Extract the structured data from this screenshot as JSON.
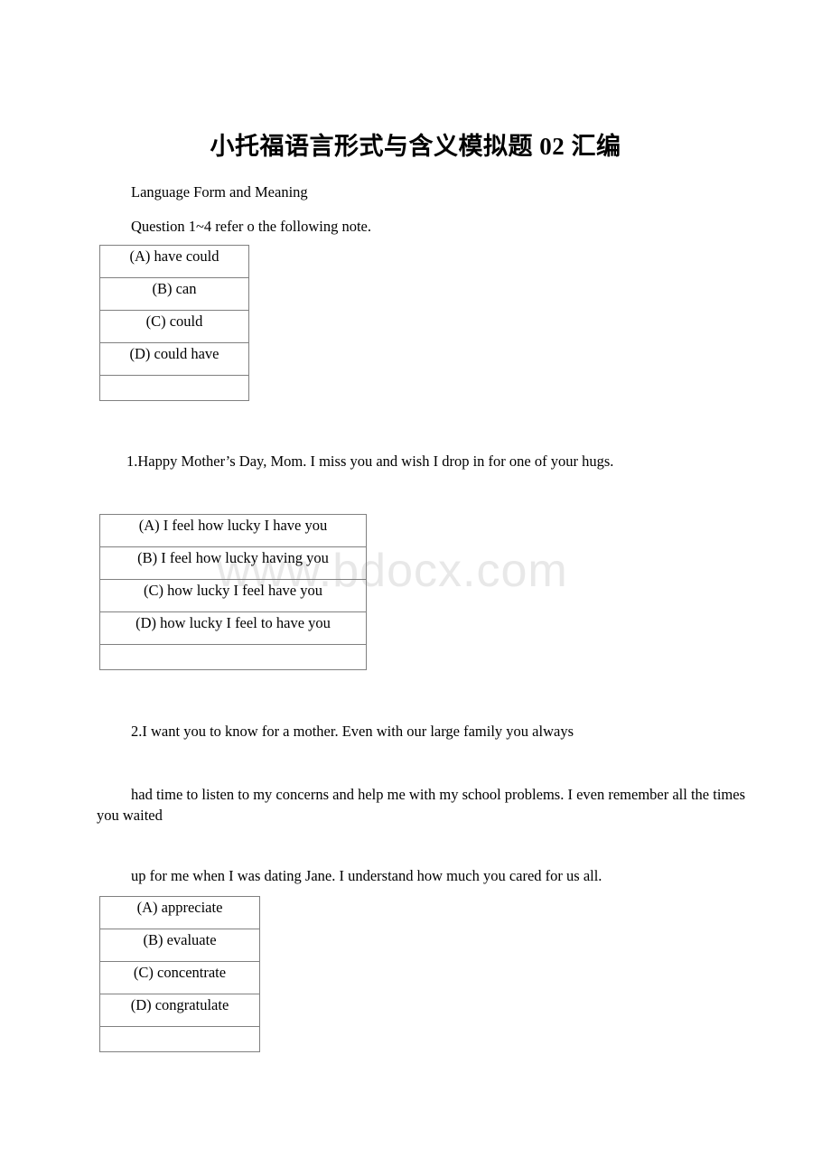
{
  "document": {
    "title": "小托福语言形式与含义模拟题 02 汇编",
    "section_heading": "Language Form and Meaning",
    "instruction": "Question 1~4 refer o the following note."
  },
  "watermark": {
    "text": "www.bdocx.com"
  },
  "questions": [
    {
      "id": "q-intro-options",
      "options": [
        "(A) have could",
        "(B) can",
        "(C) could",
        "(D) could have",
        ""
      ]
    },
    {
      "id": "q1",
      "prompt": "1.Happy Mother’s Day, Mom. I miss you and wish I drop in for one of your hugs.",
      "options": [
        "(A) I feel how lucky I have you",
        "(B) I feel how lucky having you",
        "(C) how lucky I feel have you",
        "(D) how lucky I feel to have you",
        ""
      ]
    },
    {
      "id": "q2",
      "prompt_line_1": "2.I want you to know for a mother. Even with our large family you always",
      "prompt_line_2": "had time to listen to my concerns and help me with my school problems. I even remember all the times you waited",
      "prompt_line_3": "up for me when I was dating Jane. I understand how much you cared for us all.",
      "options": [
        "(A) appreciate",
        "(B) evaluate",
        "(C) concentrate",
        "(D) congratulate",
        ""
      ]
    }
  ]
}
